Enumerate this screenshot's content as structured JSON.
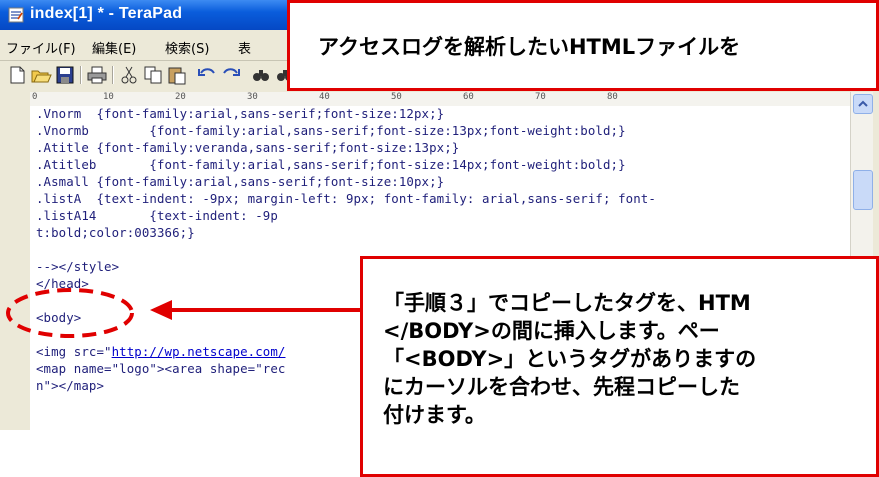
{
  "window": {
    "title": "index[1] * - TeraPad"
  },
  "menu": [
    {
      "label": "ファイル(F)"
    },
    {
      "label": "編集(E)"
    },
    {
      "label": "検索(S)"
    },
    {
      "label": "表"
    }
  ],
  "toolbar": {
    "buttons": [
      "new-file-icon",
      "open-folder-icon",
      "save-icon",
      "print-icon",
      "cut-icon",
      "copy-icon",
      "paste-icon",
      "undo-icon",
      "redo-icon",
      "find-icon",
      "find-next-icon",
      "find-prev-icon"
    ]
  },
  "ruler": {
    "marks": [
      "0",
      "10",
      "20",
      "30",
      "40",
      "50",
      "60",
      "70",
      "80"
    ]
  },
  "editor": {
    "lines": [
      ".Vnorm  {font-family:arial,sans-serif;font-size:12px;}",
      ".Vnormb        {font-family:arial,sans-serif;font-size:13px;font-weight:bold;}",
      ".Atitle {font-family:veranda,sans-serif;font-size:13px;}",
      ".Atitleb       {font-family:arial,sans-serif;font-size:14px;font-weight:bold;}",
      ".Asmall {font-family:arial,sans-serif;font-size:10px;}",
      ".listA  {text-indent: -9px; margin-left: 9px; font-family: arial,sans-serif; font-",
      ".listA14       {text-indent: -9p",
      "t:bold;color:003366;}",
      "",
      "--></style>",
      "</head>",
      "",
      "<body>",
      "",
      "<img src=\"",
      "<map name=\"logo\"><area shape=\"rec",
      "n\"></map>"
    ],
    "link_text": "http://wp.netscape.com/"
  },
  "callouts": {
    "top": "アクセスログを解析したいHTMLファイルを",
    "bottom": "「手順３」でコピーしたタグを、HTM\n</BODY>の間に挿入します。ペー\n「<BODY>」というタグがありますの\nにカーソルを合わせ、先程コピーした\n付けます。"
  },
  "colors": {
    "callout_border": "#e00000",
    "annotation_red": "#e00000",
    "titlebar": "#0a5ddc",
    "code_text": "#1f1f7a"
  }
}
